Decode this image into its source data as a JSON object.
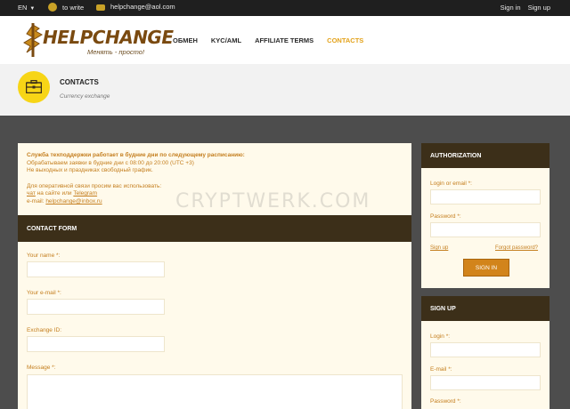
{
  "topbar": {
    "lang": "EN",
    "write_label": "to write",
    "email": "helpchange@aol.com",
    "sign_in": "Sign in",
    "sign_up": "Sign up"
  },
  "brand": {
    "name": "HELPCHANGE",
    "tagline": "Менять - просто!"
  },
  "nav": [
    "ОБМЕН",
    "KYC/AML",
    "AFFILIATE TERMS",
    "CONTACTS"
  ],
  "page": {
    "title": "CONTACTS",
    "subtitle": "Currency exchange"
  },
  "notice": {
    "line1": "Служба техподдержки работает в будние дни по следующему расписанию:",
    "line2": "Обрабатываем заявки в будние дни с 08:00 до 20:00 (UTC +3)",
    "line3": "Не выходных и праздниках свободный график.",
    "line4": "Для оперативной связи просим вас использовать:",
    "chat_link": "чат",
    "chat_mid": " на сайте или ",
    "telegram_link": "Telegram",
    "email_prefix": "e-mail: ",
    "email_link": "helpchange@inbox.ru"
  },
  "contact_form": {
    "title": "CONTACT FORM",
    "name_label": "Your name *:",
    "email_label": "Your e-mail *:",
    "exchange_label": "Exchange ID:",
    "message_label": "Message *:"
  },
  "authorization": {
    "title": "AUTHORIZATION",
    "login_label": "Login or email *:",
    "password_label": "Password *:",
    "signup_link": "Sign up",
    "forgot_link": "Forgot password?",
    "signin_button": "SIGN IN"
  },
  "signup": {
    "title": "SIGN UP",
    "login_label": "Login *:",
    "email_label": "E-mail *:",
    "password_label": "Password *:"
  },
  "watermark": "CRYPTWERK.COM",
  "colors": {
    "accent": "#e3a21a",
    "dark_panel": "#3c2f19",
    "panel_bg": "#fffaeb",
    "yellow": "#f7d516"
  }
}
